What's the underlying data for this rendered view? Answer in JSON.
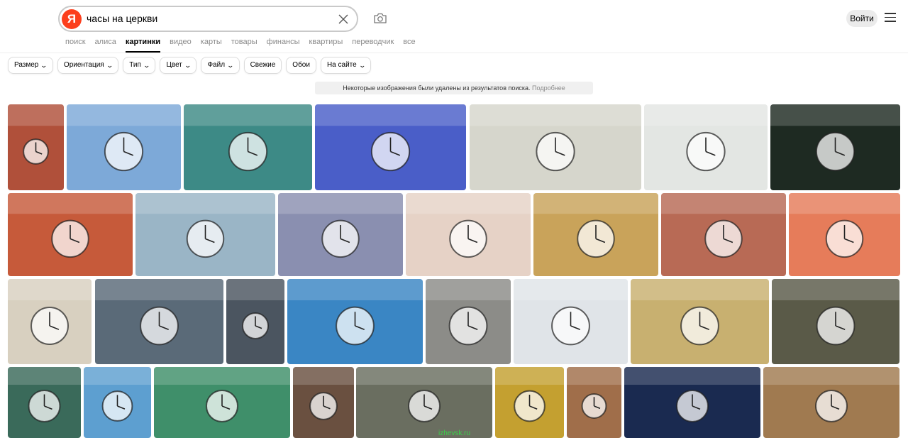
{
  "search": {
    "query": "часы на церкви"
  },
  "header": {
    "logo_letter": "Я",
    "login_label": "Войти"
  },
  "nav": [
    "поиск",
    "алиса",
    "картинки",
    "видео",
    "карты",
    "товары",
    "финансы",
    "квартиры",
    "переводчик",
    "все"
  ],
  "nav_active": "картинки",
  "filters": [
    {
      "label": "Размер",
      "dropdown": true
    },
    {
      "label": "Ориентация",
      "dropdown": true
    },
    {
      "label": "Тип",
      "dropdown": true
    },
    {
      "label": "Цвет",
      "dropdown": true
    },
    {
      "label": "Файл",
      "dropdown": true
    },
    {
      "label": "Свежие",
      "dropdown": false
    },
    {
      "label": "Обои",
      "dropdown": false
    },
    {
      "label": "На сайте",
      "dropdown": true
    }
  ],
  "notice": {
    "text": "Некоторые изображения были удалены из результатов поиска.",
    "link": "Подробнее"
  },
  "image_captions": {
    "watermark": "izhevsk.ru"
  },
  "image_colors": [
    [
      "#b0503a",
      "#7da9d8",
      "#3d8a86",
      "#4a5ec8",
      "#d6d6cc",
      "#e3e6e3",
      "#1e2a22"
    ],
    [
      "#c65a3a",
      "#9ab5c6",
      "#8a8fb0",
      "#e6d2c6",
      "#c9a35a",
      "#b86a55",
      "#e67c5a"
    ],
    [
      "#d8d0c0",
      "#5a6a78",
      "#4b5560",
      "#3a86c4",
      "#8c8c88",
      "#e0e4e8",
      "#c8b070",
      "#5a5a48"
    ],
    [
      "#3a6a5a",
      "#5d9fd0",
      "#3f8f6a",
      "#6a5040",
      "#6a6e60",
      "#c4a030",
      "#a06e4a",
      "#1a2a50",
      "#a07a50"
    ]
  ]
}
